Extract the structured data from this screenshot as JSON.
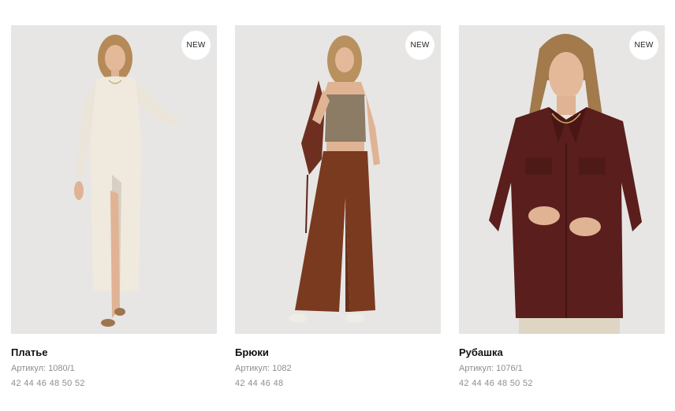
{
  "products": [
    {
      "badge": "NEW",
      "name": "Платье",
      "article": "Артикул: 1080/1",
      "sizes": "42 44 46 48 50 52",
      "garment_color": "#efe9de"
    },
    {
      "badge": "NEW",
      "name": "Брюки",
      "article": "Артикул: 1082",
      "sizes": "42 44 46 48",
      "garment_color": "#7a3a1f"
    },
    {
      "badge": "NEW",
      "name": "Рубашка",
      "article": "Артикул: 1076/1",
      "sizes": "42 44 46 48 50 52",
      "garment_color": "#5a1e1c"
    }
  ],
  "colors": {
    "photo_background": "#e7e6e5",
    "badge_background": "#ffffff",
    "muted_text": "#8e8e8e"
  }
}
